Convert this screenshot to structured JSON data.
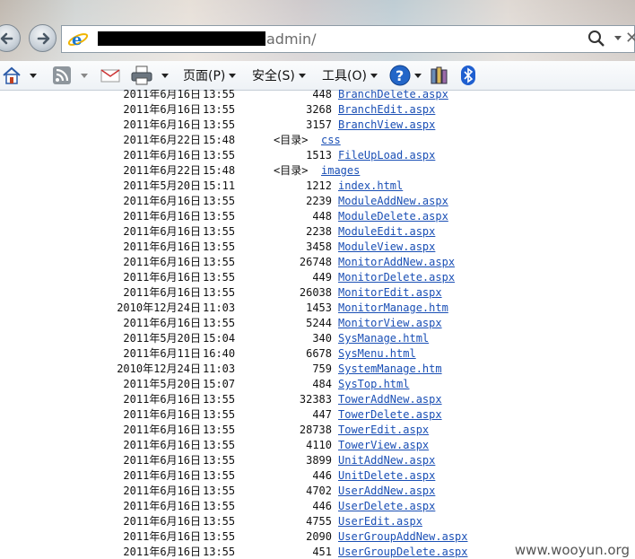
{
  "address_bar": {
    "url_visible": "admin/"
  },
  "command_bar": {
    "page_label": "页面(P)",
    "safety_label": "安全(S)",
    "tools_label": "工具(O)"
  },
  "listing": {
    "dir_tag": "<目录>",
    "rows": [
      {
        "date": "2011年6月16日",
        "time": "13:55",
        "size": "448",
        "name": "BranchDelete.aspx"
      },
      {
        "date": "2011年6月16日",
        "time": "13:55",
        "size": "3268",
        "name": "BranchEdit.aspx"
      },
      {
        "date": "2011年6月16日",
        "time": "13:55",
        "size": "3157",
        "name": "BranchView.aspx"
      },
      {
        "date": "2011年6月22日",
        "time": "15:48",
        "size": "",
        "name": "css",
        "is_dir": true
      },
      {
        "date": "2011年6月16日",
        "time": "13:55",
        "size": "1513",
        "name": "FileUpLoad.aspx"
      },
      {
        "date": "2011年6月22日",
        "time": "15:48",
        "size": "",
        "name": "images",
        "is_dir": true
      },
      {
        "date": "2011年5月20日",
        "time": "15:11",
        "size": "1212",
        "name": "index.html"
      },
      {
        "date": "2011年6月16日",
        "time": "13:55",
        "size": "2239",
        "name": "ModuleAddNew.aspx"
      },
      {
        "date": "2011年6月16日",
        "time": "13:55",
        "size": "448",
        "name": "ModuleDelete.aspx"
      },
      {
        "date": "2011年6月16日",
        "time": "13:55",
        "size": "2238",
        "name": "ModuleEdit.aspx"
      },
      {
        "date": "2011年6月16日",
        "time": "13:55",
        "size": "3458",
        "name": "ModuleView.aspx"
      },
      {
        "date": "2011年6月16日",
        "time": "13:55",
        "size": "26748",
        "name": "MonitorAddNew.aspx"
      },
      {
        "date": "2011年6月16日",
        "time": "13:55",
        "size": "449",
        "name": "MonitorDelete.aspx"
      },
      {
        "date": "2011年6月16日",
        "time": "13:55",
        "size": "26038",
        "name": "MonitorEdit.aspx"
      },
      {
        "date": "2010年12月24日",
        "time": "11:03",
        "size": "1453",
        "name": "MonitorManage.htm"
      },
      {
        "date": "2011年6月16日",
        "time": "13:55",
        "size": "5244",
        "name": "MonitorView.aspx"
      },
      {
        "date": "2011年5月20日",
        "time": "15:04",
        "size": "340",
        "name": "SysManage.html"
      },
      {
        "date": "2011年6月11日",
        "time": "16:40",
        "size": "6678",
        "name": "SysMenu.html"
      },
      {
        "date": "2010年12月24日",
        "time": "11:03",
        "size": "759",
        "name": "SystemManage.htm"
      },
      {
        "date": "2011年5月20日",
        "time": "15:07",
        "size": "484",
        "name": "SysTop.html"
      },
      {
        "date": "2011年6月16日",
        "time": "13:55",
        "size": "32383",
        "name": "TowerAddNew.aspx"
      },
      {
        "date": "2011年6月16日",
        "time": "13:55",
        "size": "447",
        "name": "TowerDelete.aspx"
      },
      {
        "date": "2011年6月16日",
        "time": "13:55",
        "size": "28738",
        "name": "TowerEdit.aspx"
      },
      {
        "date": "2011年6月16日",
        "time": "13:55",
        "size": "4110",
        "name": "TowerView.aspx"
      },
      {
        "date": "2011年6月16日",
        "time": "13:55",
        "size": "3899",
        "name": "UnitAddNew.aspx"
      },
      {
        "date": "2011年6月16日",
        "time": "13:55",
        "size": "446",
        "name": "UnitDelete.aspx"
      },
      {
        "date": "2011年6月16日",
        "time": "13:55",
        "size": "4702",
        "name": "UserAddNew.aspx"
      },
      {
        "date": "2011年6月16日",
        "time": "13:55",
        "size": "446",
        "name": "UserDelete.aspx"
      },
      {
        "date": "2011年6月16日",
        "time": "13:55",
        "size": "4755",
        "name": "UserEdit.aspx"
      },
      {
        "date": "2011年6月16日",
        "time": "13:55",
        "size": "2090",
        "name": "UserGroupAddNew.aspx"
      },
      {
        "date": "2011年6月16日",
        "time": "13:55",
        "size": "451",
        "name": "UserGroupDelete.aspx"
      }
    ]
  },
  "watermark": "www.wooyun.org",
  "colors": {
    "link": "#1a4fb5",
    "text": "#111111",
    "background": "#ffffff"
  },
  "icons": [
    "back-arrow-icon",
    "forward-arrow-icon",
    "ie-logo-icon",
    "search-icon",
    "home-icon",
    "rss-feed-icon",
    "mail-icon",
    "print-icon",
    "help-icon",
    "research-icon",
    "bluetooth-icon"
  ]
}
